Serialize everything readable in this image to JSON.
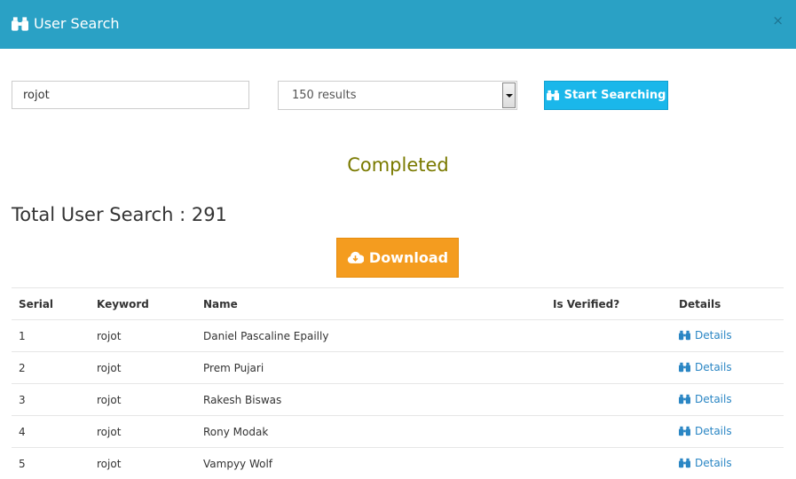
{
  "header": {
    "title": "User Search",
    "close_label": "×",
    "color": "#2aa1c5"
  },
  "search": {
    "value": "rojot",
    "results_select": "150 results",
    "start_label": "Start Searching"
  },
  "status": "Completed",
  "total_label": "Total User Search : 291",
  "download_label": "Download",
  "table": {
    "columns": [
      "Serial",
      "Keyword",
      "Name",
      "Is Verified?",
      "Details"
    ],
    "rows": [
      {
        "serial": "1",
        "keyword": "rojot",
        "name": "Daniel Pascaline Epailly",
        "verified": "",
        "details": "Details"
      },
      {
        "serial": "2",
        "keyword": "rojot",
        "name": "Prem Pujari",
        "verified": "",
        "details": "Details"
      },
      {
        "serial": "3",
        "keyword": "rojot",
        "name": "Rakesh Biswas",
        "verified": "",
        "details": "Details"
      },
      {
        "serial": "4",
        "keyword": "rojot",
        "name": "Rony Modak",
        "verified": "",
        "details": "Details"
      },
      {
        "serial": "5",
        "keyword": "rojot",
        "name": "Vampyy Wolf",
        "verified": "",
        "details": "Details"
      }
    ]
  },
  "icons": {
    "header": "binoculars-icon",
    "start": "binoculars-icon",
    "download": "cloud-download-icon",
    "details": "binoculars-icon"
  }
}
